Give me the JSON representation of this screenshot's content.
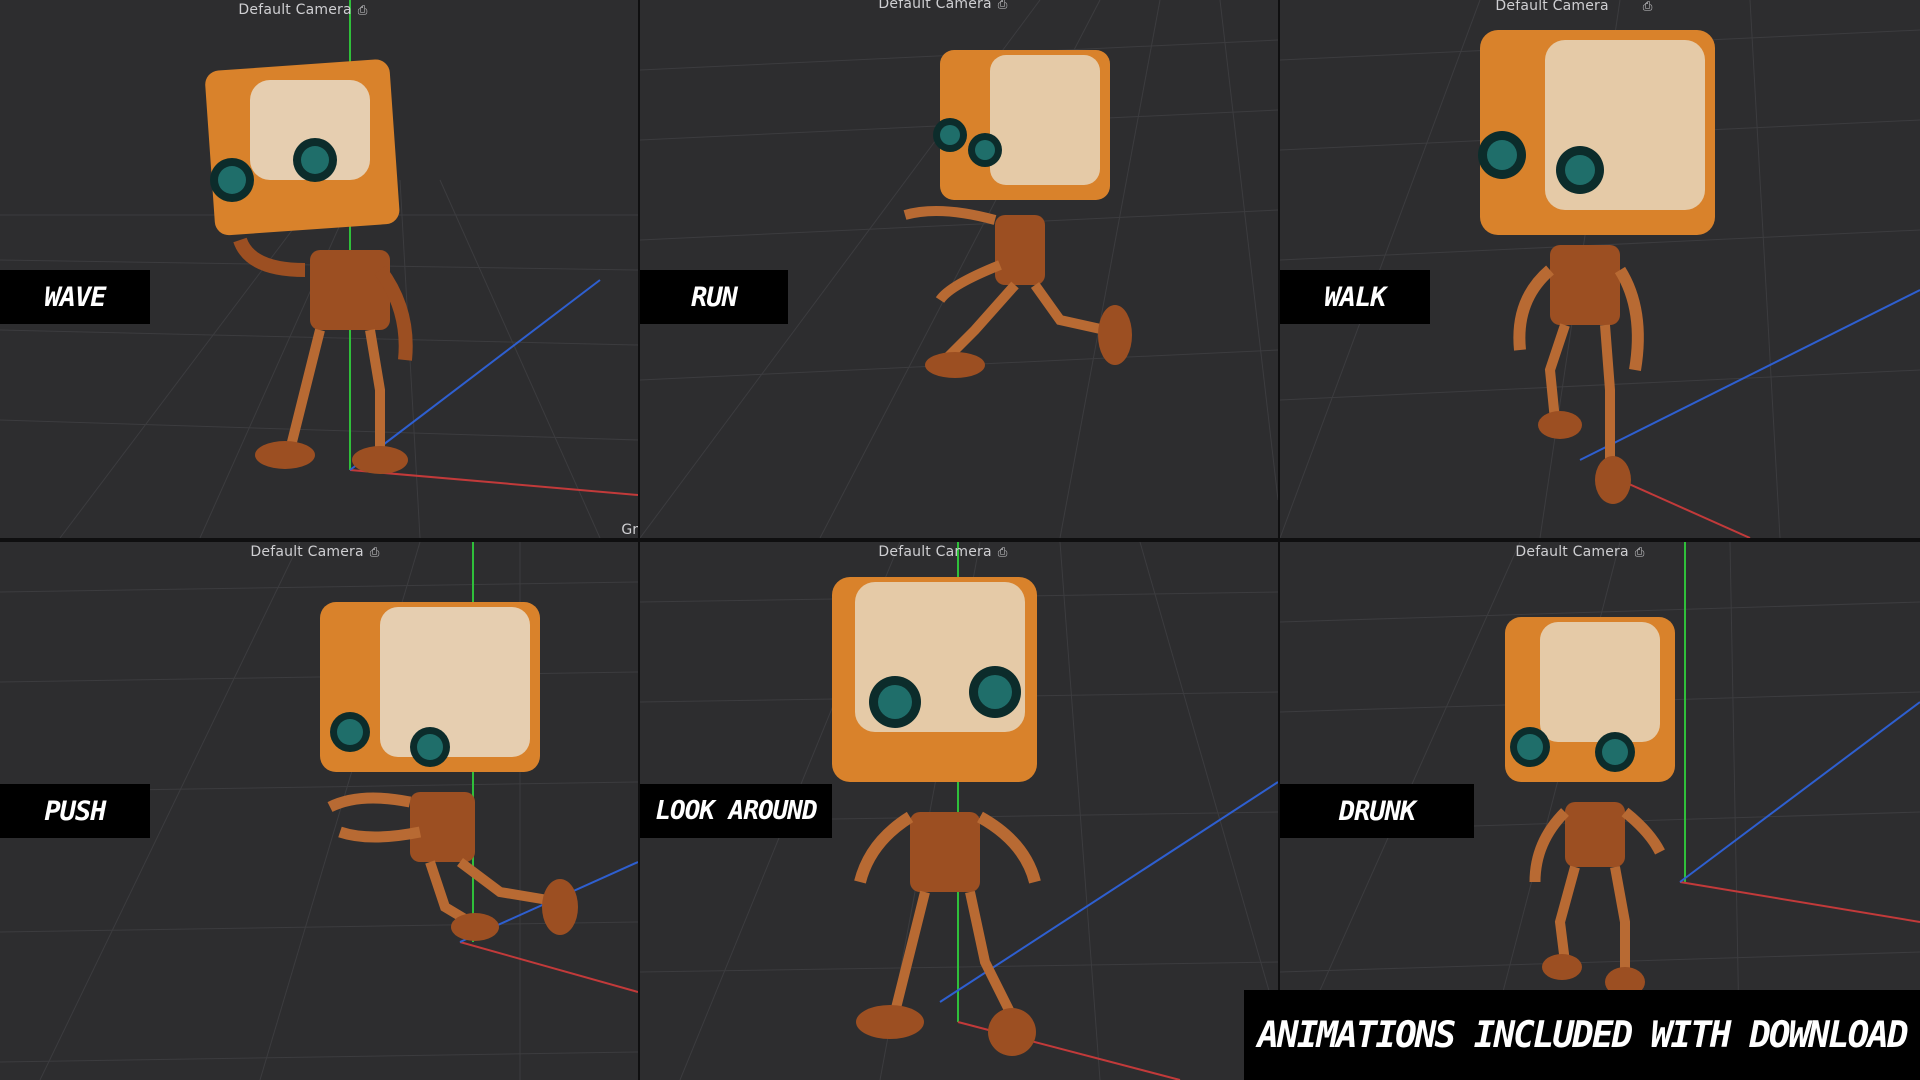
{
  "viewports": [
    {
      "camera": "Default Camera",
      "animation": "WAVE",
      "corner": "Gr"
    },
    {
      "camera": "Default Camera",
      "animation": "RUN"
    },
    {
      "camera": "Default Camera",
      "animation": "WALK"
    },
    {
      "camera": "Default Camera",
      "animation": "PUSH"
    },
    {
      "camera": "Default Camera",
      "animation": "LOOK AROUND"
    },
    {
      "camera": "Default Camera",
      "animation": "DRUNK"
    }
  ],
  "banner": "ANIMATIONS INCLUDED WITH DOWNLOAD",
  "icons": {
    "camera": "camera-icon"
  },
  "colors": {
    "viewport_bg": "#2d2d2f",
    "grid_line": "#3c3c3f",
    "robot_orange": "#d9822b",
    "robot_rust": "#9c4f22",
    "robot_pale": "#e8e1d2",
    "eye_teal": "#1f6e6a",
    "axis_red": "#c23a3a",
    "axis_green": "#2fbf3a",
    "axis_blue": "#2e5fd0"
  }
}
